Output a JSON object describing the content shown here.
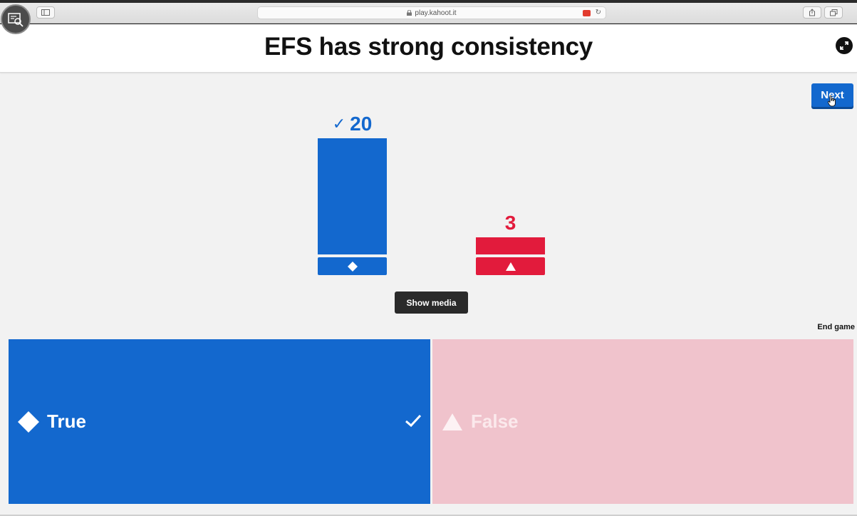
{
  "browser": {
    "url": "play.kahoot.it",
    "icons": [
      "sidebar-icon",
      "lock-icon",
      "extension-icon",
      "reload-icon",
      "share-icon",
      "tabs-icon",
      "screen-recorder-icon"
    ]
  },
  "header": {
    "question": "EFS has strong consistency"
  },
  "controls": {
    "next_label": "Next",
    "show_media_label": "Show media",
    "end_game_label": "End game"
  },
  "results": {
    "correct_mark": "✓",
    "true_count": "20",
    "false_count": "3"
  },
  "answers": [
    {
      "label": "True",
      "shape": "diamond",
      "correct": true,
      "color": "#1368ce"
    },
    {
      "label": "False",
      "shape": "triangle",
      "correct": false,
      "color": "#e21b3c"
    }
  ],
  "chart_data": {
    "type": "bar",
    "categories": [
      "True",
      "False"
    ],
    "values": [
      20,
      3
    ],
    "colors": [
      "#1368ce",
      "#e21b3c"
    ],
    "correct_category": "True"
  }
}
